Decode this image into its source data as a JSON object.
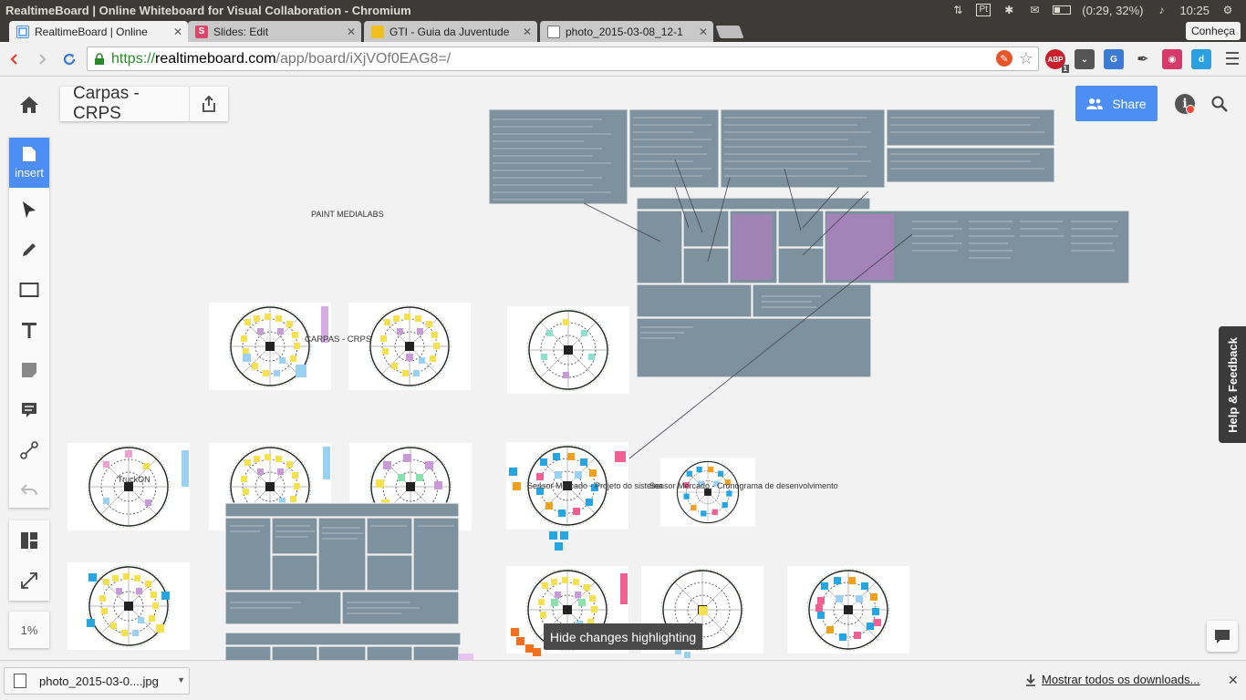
{
  "os": {
    "window_title": "RealtimeBoard | Online Whiteboard for Visual Collaboration - Chromium",
    "battery": "(0:29, 32%)",
    "clock": "10:25",
    "pt_badge": "Pt"
  },
  "tabs": [
    {
      "label": "RealtimeBoard | Online",
      "icon": "realtimeboard-icon",
      "active": true
    },
    {
      "label": "Slides: Edit",
      "icon": "slides-icon",
      "active": false
    },
    {
      "label": "GTI - Guia da Juventude",
      "icon": "gti-icon",
      "active": false
    },
    {
      "label": "photo_2015-03-08_12-1",
      "icon": "document-icon",
      "active": false
    }
  ],
  "profile_button": "Conheça",
  "url": {
    "scheme": "https://",
    "host": "realtimeboard.com",
    "path": "/app/board/iXjVOf0EAG8=/"
  },
  "extensions": {
    "abp_label": "ABP",
    "abp_count": "1"
  },
  "board": {
    "title": "Carpas - CRPS",
    "share_label": "Share",
    "insert_label": "insert",
    "zoom": "1%",
    "feedback_label": "Help & Feedback",
    "hide_changes_label": "Hide changes highlighting"
  },
  "canvas_labels": {
    "marketing_top": "PAINT MEDIALABS",
    "carpas_crps": "CARPAS - CRPS",
    "truckon": "TruckON",
    "sensor_projeto": "Sensor Mercado - Projeto do sistema",
    "sensor_cronograma": "Sensor Mercado - Cronograma de desenvolvimento"
  },
  "downloads": {
    "file": "photo_2015-03-0....jpg",
    "show_all": "Mostrar todos os downloads..."
  },
  "colors": {
    "accent": "#4d8ef5",
    "board_bg": "#f2f2f2",
    "card_slate": "#7d919e",
    "canvas_green": "#3aa53a"
  }
}
